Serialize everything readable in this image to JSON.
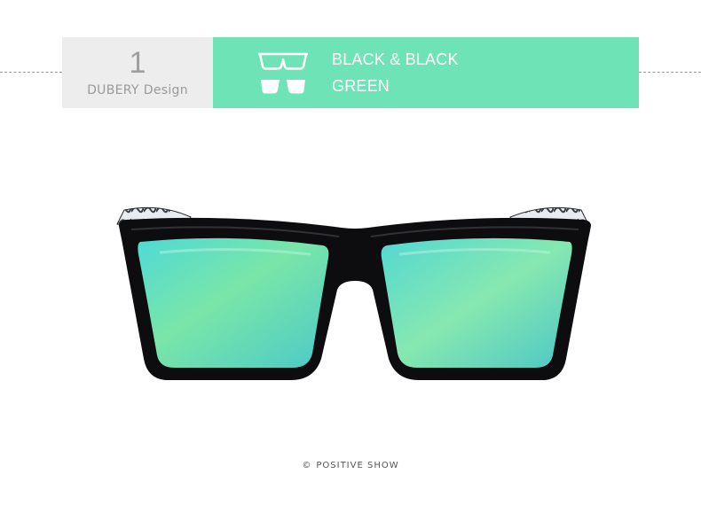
{
  "card": {
    "number": "1",
    "brand": "DUBERY",
    "design": "Design",
    "frame_color": "BLACK & BLACK",
    "lens_color": "GREEN",
    "accent_color": "#6de3b6",
    "panel_color": "#ededed",
    "icons": {
      "frame": "glasses-frame-icon",
      "lens": "glasses-lens-icon"
    }
  },
  "product": {
    "frame_color_hex": "#0d0d0f",
    "lens_color_hex": "#7fe6b3"
  },
  "footer": {
    "copyright_symbol": "©",
    "credit": "POSITIVE SHOW"
  }
}
